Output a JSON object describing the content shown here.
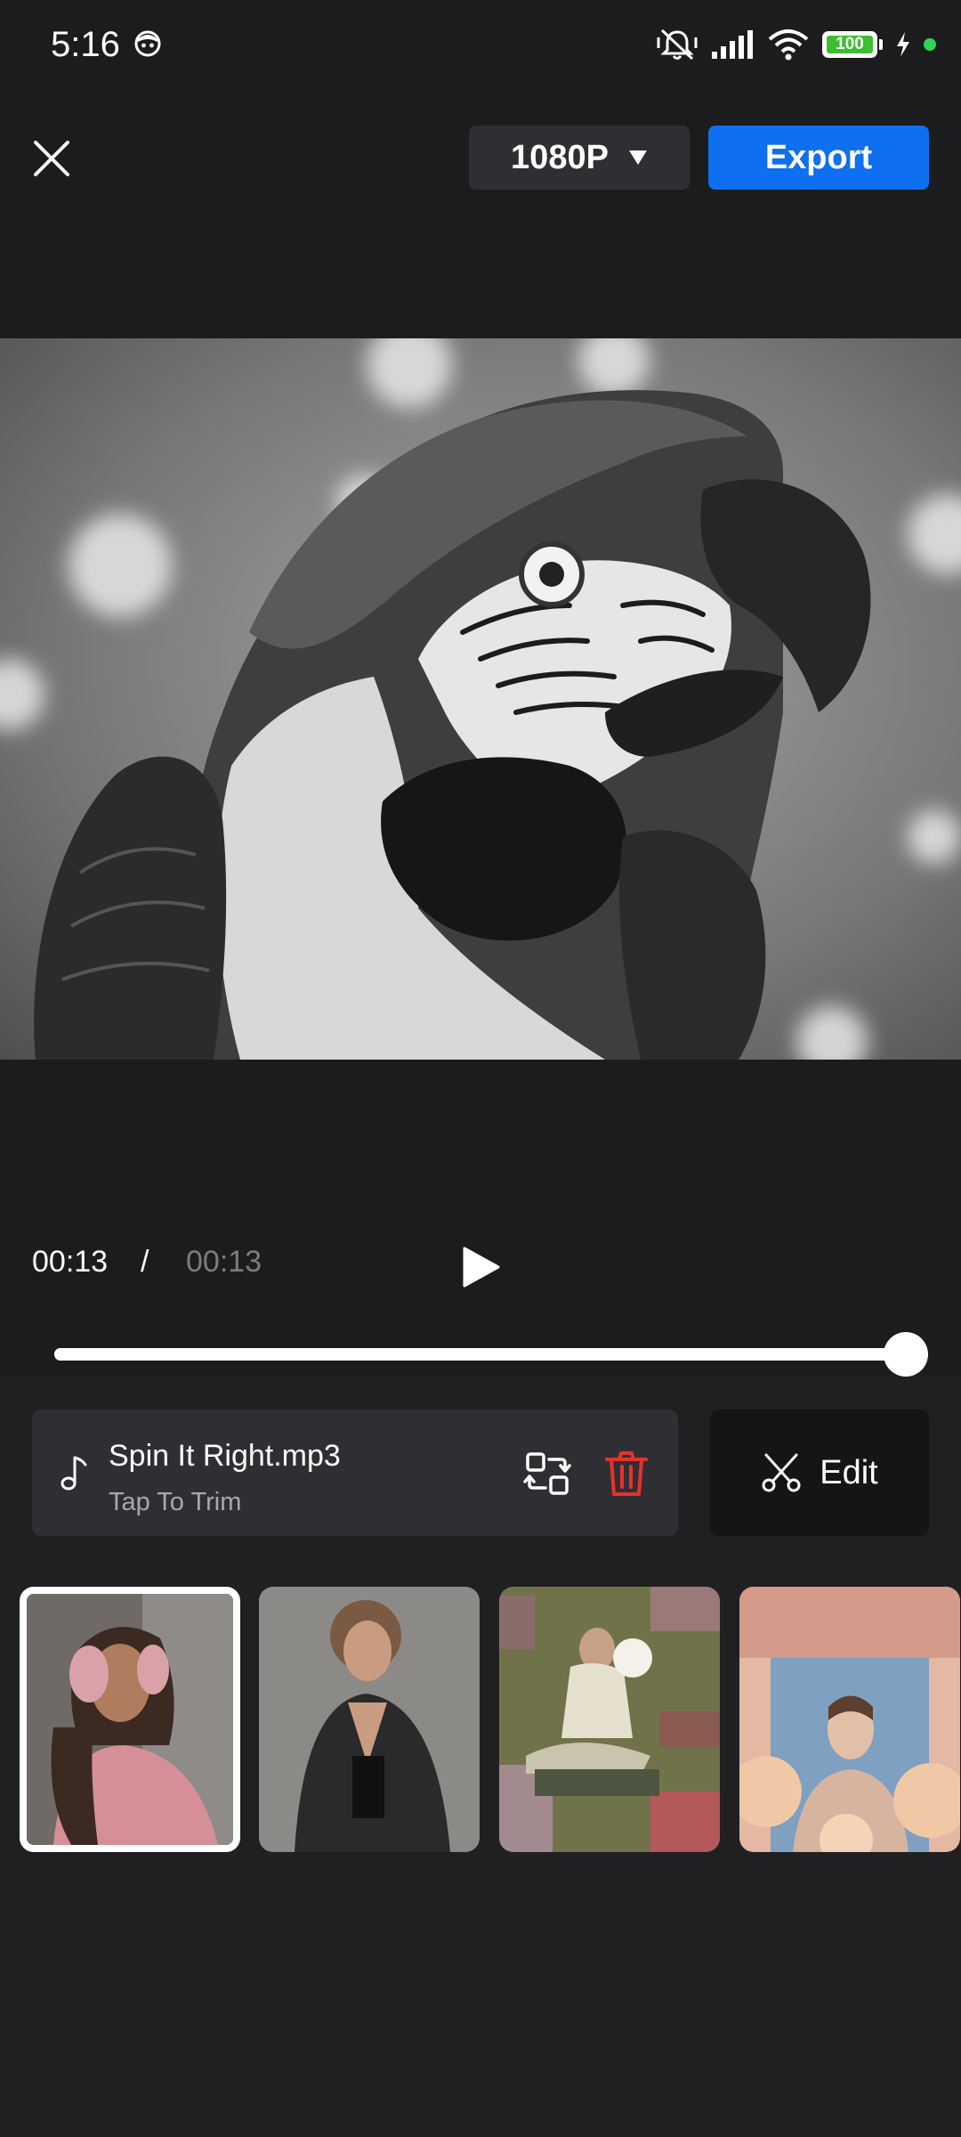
{
  "status_bar": {
    "time": "5:16",
    "battery": "100"
  },
  "header": {
    "resolution": "1080P",
    "export_label": "Export"
  },
  "playback": {
    "current_time": "00:13",
    "separator": "/",
    "total_time": "00:13",
    "progress": 1.0
  },
  "music": {
    "title": "Spin It Right.mp3",
    "subtitle": "Tap To Trim"
  },
  "edit": {
    "label": "Edit"
  },
  "colors": {
    "accent": "#0e6ff0",
    "delete": "#e8312b",
    "battery": "#3cbf2f",
    "charging_dot": "#2fd655"
  }
}
